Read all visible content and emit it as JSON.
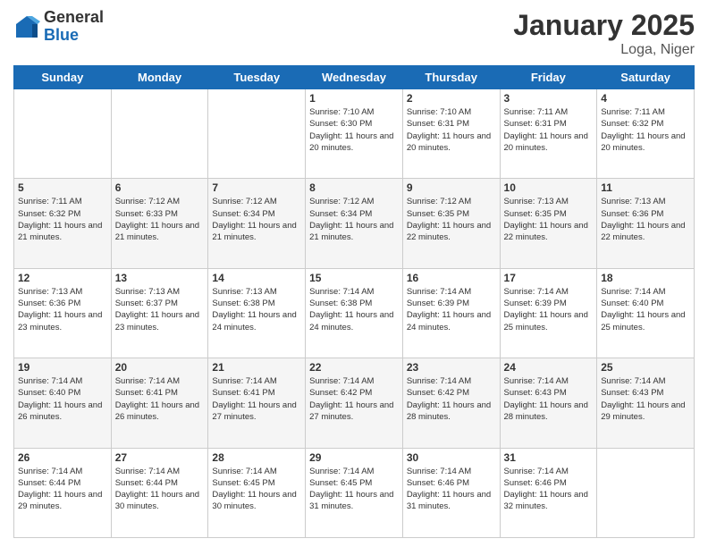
{
  "header": {
    "logo_general": "General",
    "logo_blue": "Blue",
    "month_title": "January 2025",
    "location": "Loga, Niger"
  },
  "weekdays": [
    "Sunday",
    "Monday",
    "Tuesday",
    "Wednesday",
    "Thursday",
    "Friday",
    "Saturday"
  ],
  "weeks": [
    [
      {
        "day": "",
        "info": ""
      },
      {
        "day": "",
        "info": ""
      },
      {
        "day": "",
        "info": ""
      },
      {
        "day": "1",
        "info": "Sunrise: 7:10 AM\nSunset: 6:30 PM\nDaylight: 11 hours and 20 minutes."
      },
      {
        "day": "2",
        "info": "Sunrise: 7:10 AM\nSunset: 6:31 PM\nDaylight: 11 hours and 20 minutes."
      },
      {
        "day": "3",
        "info": "Sunrise: 7:11 AM\nSunset: 6:31 PM\nDaylight: 11 hours and 20 minutes."
      },
      {
        "day": "4",
        "info": "Sunrise: 7:11 AM\nSunset: 6:32 PM\nDaylight: 11 hours and 20 minutes."
      }
    ],
    [
      {
        "day": "5",
        "info": "Sunrise: 7:11 AM\nSunset: 6:32 PM\nDaylight: 11 hours and 21 minutes."
      },
      {
        "day": "6",
        "info": "Sunrise: 7:12 AM\nSunset: 6:33 PM\nDaylight: 11 hours and 21 minutes."
      },
      {
        "day": "7",
        "info": "Sunrise: 7:12 AM\nSunset: 6:34 PM\nDaylight: 11 hours and 21 minutes."
      },
      {
        "day": "8",
        "info": "Sunrise: 7:12 AM\nSunset: 6:34 PM\nDaylight: 11 hours and 21 minutes."
      },
      {
        "day": "9",
        "info": "Sunrise: 7:12 AM\nSunset: 6:35 PM\nDaylight: 11 hours and 22 minutes."
      },
      {
        "day": "10",
        "info": "Sunrise: 7:13 AM\nSunset: 6:35 PM\nDaylight: 11 hours and 22 minutes."
      },
      {
        "day": "11",
        "info": "Sunrise: 7:13 AM\nSunset: 6:36 PM\nDaylight: 11 hours and 22 minutes."
      }
    ],
    [
      {
        "day": "12",
        "info": "Sunrise: 7:13 AM\nSunset: 6:36 PM\nDaylight: 11 hours and 23 minutes."
      },
      {
        "day": "13",
        "info": "Sunrise: 7:13 AM\nSunset: 6:37 PM\nDaylight: 11 hours and 23 minutes."
      },
      {
        "day": "14",
        "info": "Sunrise: 7:13 AM\nSunset: 6:38 PM\nDaylight: 11 hours and 24 minutes."
      },
      {
        "day": "15",
        "info": "Sunrise: 7:14 AM\nSunset: 6:38 PM\nDaylight: 11 hours and 24 minutes."
      },
      {
        "day": "16",
        "info": "Sunrise: 7:14 AM\nSunset: 6:39 PM\nDaylight: 11 hours and 24 minutes."
      },
      {
        "day": "17",
        "info": "Sunrise: 7:14 AM\nSunset: 6:39 PM\nDaylight: 11 hours and 25 minutes."
      },
      {
        "day": "18",
        "info": "Sunrise: 7:14 AM\nSunset: 6:40 PM\nDaylight: 11 hours and 25 minutes."
      }
    ],
    [
      {
        "day": "19",
        "info": "Sunrise: 7:14 AM\nSunset: 6:40 PM\nDaylight: 11 hours and 26 minutes."
      },
      {
        "day": "20",
        "info": "Sunrise: 7:14 AM\nSunset: 6:41 PM\nDaylight: 11 hours and 26 minutes."
      },
      {
        "day": "21",
        "info": "Sunrise: 7:14 AM\nSunset: 6:41 PM\nDaylight: 11 hours and 27 minutes."
      },
      {
        "day": "22",
        "info": "Sunrise: 7:14 AM\nSunset: 6:42 PM\nDaylight: 11 hours and 27 minutes."
      },
      {
        "day": "23",
        "info": "Sunrise: 7:14 AM\nSunset: 6:42 PM\nDaylight: 11 hours and 28 minutes."
      },
      {
        "day": "24",
        "info": "Sunrise: 7:14 AM\nSunset: 6:43 PM\nDaylight: 11 hours and 28 minutes."
      },
      {
        "day": "25",
        "info": "Sunrise: 7:14 AM\nSunset: 6:43 PM\nDaylight: 11 hours and 29 minutes."
      }
    ],
    [
      {
        "day": "26",
        "info": "Sunrise: 7:14 AM\nSunset: 6:44 PM\nDaylight: 11 hours and 29 minutes."
      },
      {
        "day": "27",
        "info": "Sunrise: 7:14 AM\nSunset: 6:44 PM\nDaylight: 11 hours and 30 minutes."
      },
      {
        "day": "28",
        "info": "Sunrise: 7:14 AM\nSunset: 6:45 PM\nDaylight: 11 hours and 30 minutes."
      },
      {
        "day": "29",
        "info": "Sunrise: 7:14 AM\nSunset: 6:45 PM\nDaylight: 11 hours and 31 minutes."
      },
      {
        "day": "30",
        "info": "Sunrise: 7:14 AM\nSunset: 6:46 PM\nDaylight: 11 hours and 31 minutes."
      },
      {
        "day": "31",
        "info": "Sunrise: 7:14 AM\nSunset: 6:46 PM\nDaylight: 11 hours and 32 minutes."
      },
      {
        "day": "",
        "info": ""
      }
    ]
  ]
}
